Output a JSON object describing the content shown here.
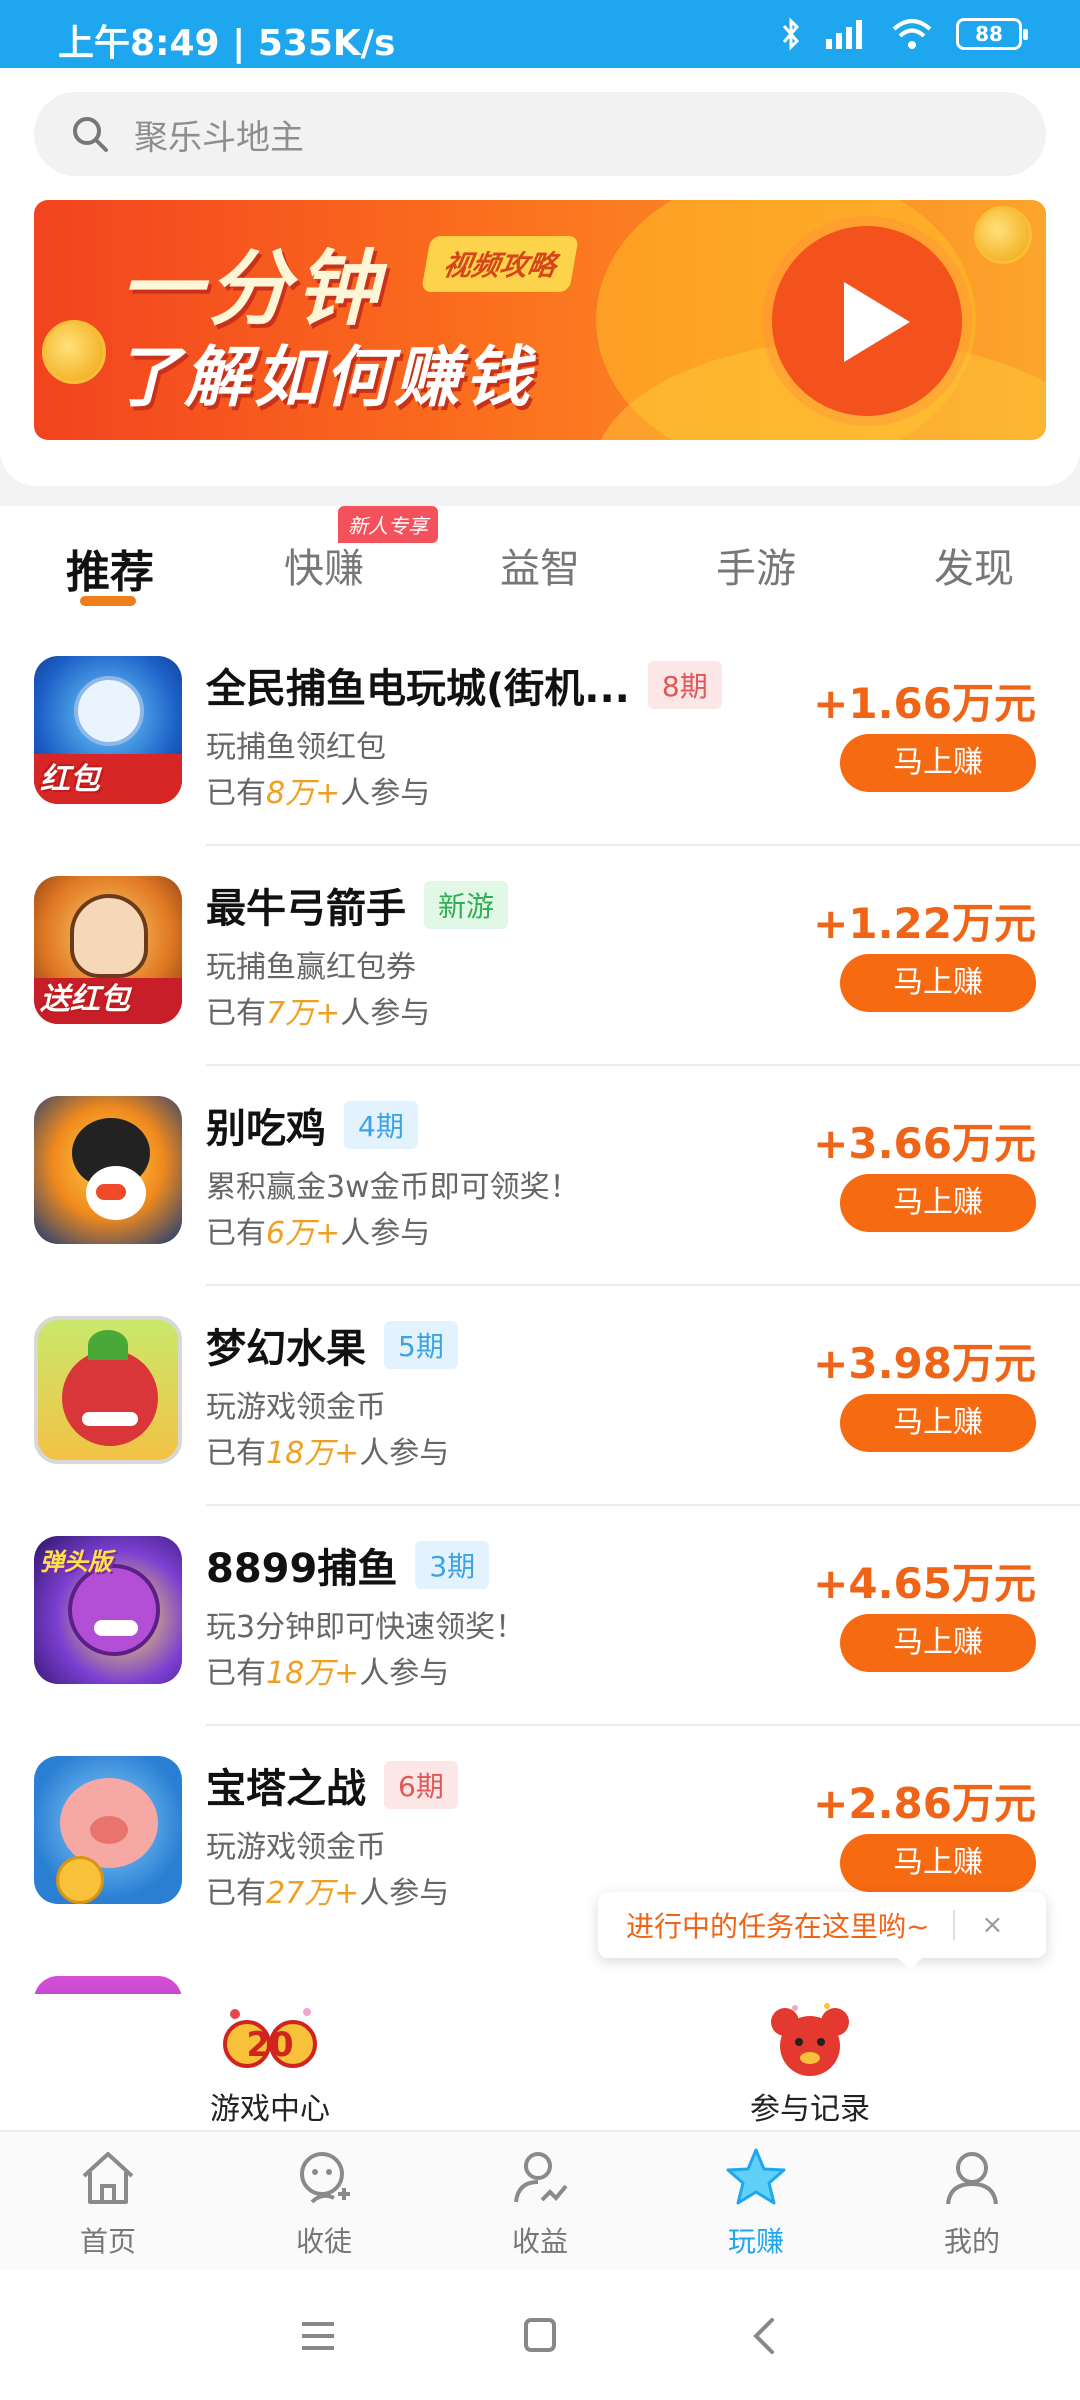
{
  "status_bar": {
    "time_speed": "上午8:49 | 535K/s",
    "battery": "88",
    "icons": [
      "bluetooth-icon",
      "signal-icon",
      "wifi-icon",
      "battery-icon"
    ]
  },
  "search": {
    "placeholder": "聚乐斗地主"
  },
  "banner": {
    "title": "一分钟",
    "badge": "视频攻略",
    "subtitle": "了解如何赚钱"
  },
  "tabs": {
    "items": [
      {
        "label": "推荐",
        "active": true
      },
      {
        "label": "快赚",
        "active": false
      },
      {
        "label": "益智",
        "active": false
      },
      {
        "label": "手游",
        "active": false
      },
      {
        "label": "发现",
        "active": false
      }
    ],
    "new_badge": "新人专享"
  },
  "games": [
    {
      "name": "全民捕鱼电玩城(街机...",
      "tag": "8期",
      "desc": "玩捕鱼领红包",
      "joined_prefix": "已有",
      "joined_count": "8万+",
      "joined_suffix": "人参与",
      "reward": "+1.66万元",
      "button": "马上赚",
      "thumb_label": "红包"
    },
    {
      "name": "最牛弓箭手",
      "tag": "新游",
      "desc": "玩捕鱼赢红包券",
      "joined_prefix": "已有",
      "joined_count": "7万+",
      "joined_suffix": "人参与",
      "reward": "+1.22万元",
      "button": "马上赚",
      "thumb_label": "送红包"
    },
    {
      "name": "别吃鸡",
      "tag": "4期",
      "desc": "累积赢金3w金币即可领奖！",
      "joined_prefix": "已有",
      "joined_count": "6万+",
      "joined_suffix": "人参与",
      "reward": "+3.66万元",
      "button": "马上赚",
      "thumb_label": ""
    },
    {
      "name": "梦幻水果",
      "tag": "5期",
      "desc": "玩游戏领金币",
      "joined_prefix": "已有",
      "joined_count": "18万+",
      "joined_suffix": "人参与",
      "reward": "+3.98万元",
      "button": "马上赚",
      "thumb_label": ""
    },
    {
      "name": "8899捕鱼",
      "tag": "3期",
      "desc": "玩3分钟即可快速领奖！",
      "joined_prefix": "已有",
      "joined_count": "18万+",
      "joined_suffix": "人参与",
      "reward": "+4.65万元",
      "button": "马上赚",
      "thumb_label": "弹头版"
    },
    {
      "name": "宝塔之战",
      "tag": "6期",
      "desc": "玩游戏领金币",
      "joined_prefix": "已有",
      "joined_count": "27万+",
      "joined_suffix": "人参与",
      "reward": "+2.86万元",
      "button": "马上赚",
      "thumb_label": ""
    }
  ],
  "tooltip": {
    "text": "进行中的任务在这里哟~",
    "close": "×"
  },
  "quick_entries": [
    {
      "label": "游戏中心",
      "icon": "game-center-2020-icon"
    },
    {
      "label": "参与记录",
      "icon": "participation-record-icon"
    }
  ],
  "bottom_nav": [
    {
      "label": "首页",
      "icon": "home-icon",
      "active": false
    },
    {
      "label": "收徒",
      "icon": "recruit-icon",
      "active": false
    },
    {
      "label": "收益",
      "icon": "earnings-icon",
      "active": false
    },
    {
      "label": "玩赚",
      "icon": "star-icon",
      "active": true
    },
    {
      "label": "我的",
      "icon": "profile-icon",
      "active": false
    }
  ],
  "colors": {
    "status_bar": "#1ea7ee",
    "accent_orange": "#f66a12",
    "active_nav": "#1ea7ee",
    "tab_underline": "#f07e19"
  }
}
